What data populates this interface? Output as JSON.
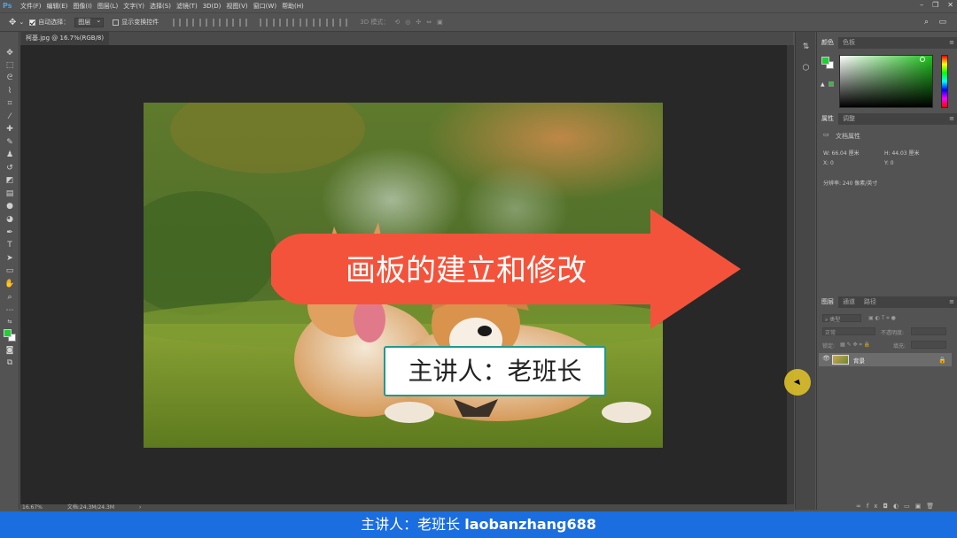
{
  "app": {
    "logo": "Ps",
    "menu": [
      "文件(F)",
      "编辑(E)",
      "图像(I)",
      "图层(L)",
      "文字(Y)",
      "选择(S)",
      "滤镜(T)",
      "3D(D)",
      "视图(V)",
      "窗口(W)",
      "帮助(H)"
    ],
    "window_controls": [
      "–",
      "❐",
      "✕"
    ]
  },
  "options_bar": {
    "auto_select_label": "自动选择：",
    "auto_select_checked": true,
    "target_value": "图层",
    "transform_controls_label": "显示变换控件",
    "transform_controls_checked": false,
    "mode_3d_label": "3D 模式："
  },
  "document": {
    "tab_title": "柯基.jpg @ 16.7%(RGB/8)",
    "tab_close": "×",
    "zoom": "16.67%",
    "doc_size": "文档:24.3M/24.3M",
    "status_arrow": "›"
  },
  "color_panel": {
    "tabs": [
      "颜色",
      "色板"
    ],
    "foreground": "#1fcf35",
    "background": "#ffffff"
  },
  "properties_panel": {
    "tabs": [
      "属性",
      "调整"
    ],
    "section": "文档属性",
    "w": "W:  66.04 厘米",
    "h": "H:  44.03 厘米",
    "x": "X:  0",
    "y": "Y:  0",
    "resolution": "分辨率: 240 像素/英寸"
  },
  "layers_panel": {
    "tabs": [
      "图层",
      "通道",
      "路径"
    ],
    "kind": "类型",
    "blend_mode": "正常",
    "opacity_label": "不透明度:",
    "lock_label": "锁定:",
    "fill_label": "填充:",
    "layers": [
      {
        "name": "背景",
        "visible": true,
        "locked": true
      }
    ]
  },
  "overlay": {
    "title": "画板的建立和修改",
    "presenter": "主讲人：老班长",
    "banner_prefix": "主讲人：老班长 ",
    "banner_handle": "laobanzhang688",
    "arrow_color": "#f4533b",
    "presenter_border": "#1f9a8e",
    "banner_color": "#1b6ee0"
  },
  "icons": {
    "toolbar": [
      "move-icon",
      "marquee-icon",
      "lasso-icon",
      "quick-select-icon",
      "crop-icon",
      "eyedropper-icon",
      "healing-icon",
      "brush-icon",
      "stamp-icon",
      "history-brush-icon",
      "eraser-icon",
      "gradient-icon",
      "blur-icon",
      "dodge-icon",
      "pen-icon",
      "type-icon",
      "path-select-icon",
      "rectangle-icon",
      "hand-icon",
      "zoom-icon",
      "more-icon"
    ]
  }
}
